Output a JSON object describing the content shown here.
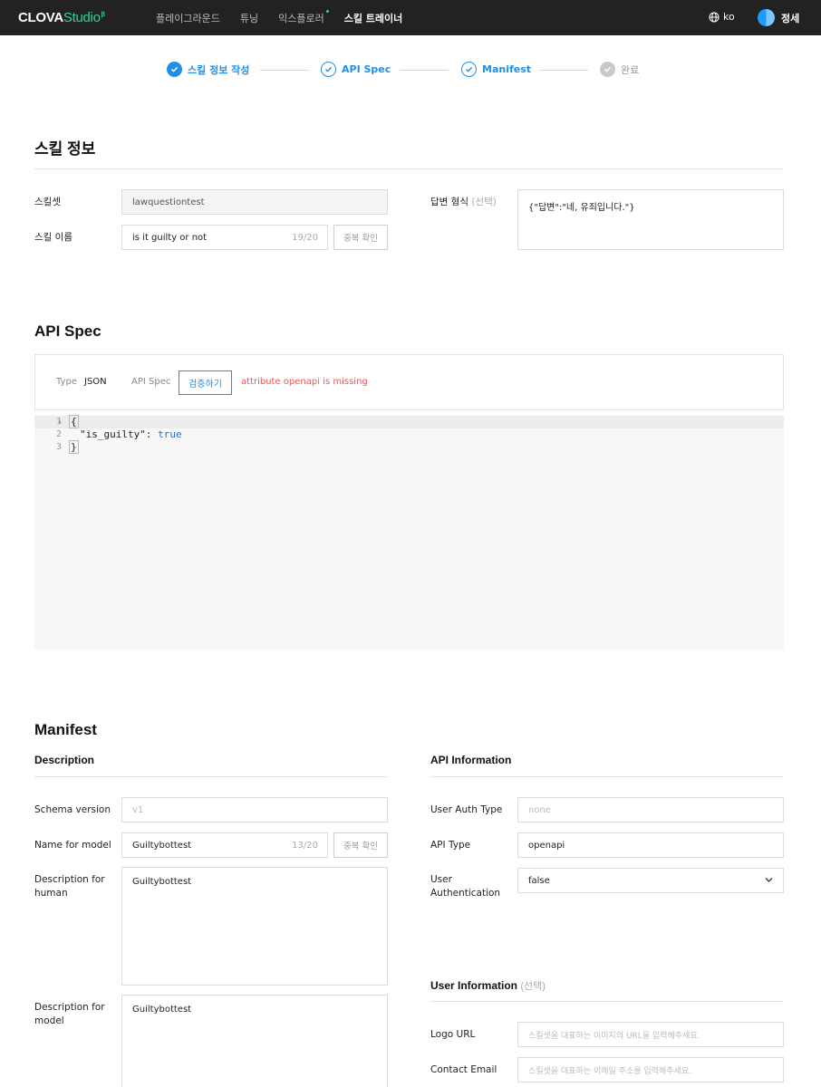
{
  "topbar": {
    "logo_main": "CLOVA",
    "logo_studio": "Studio",
    "logo_sup": "β",
    "nav": [
      "플레이그라운드",
      "튜닝",
      "익스플로러",
      "스킬 트레이너"
    ],
    "lang": "ko",
    "user_name": "정세"
  },
  "stepper": {
    "steps": [
      "스킬 정보 작성",
      "API Spec",
      "Manifest",
      "완료"
    ]
  },
  "skill_info": {
    "title": "스킬 정보",
    "skillset_label": "스킬셋",
    "skillset_value": "lawquestiontest",
    "skill_name_label": "스킬 이름",
    "skill_name_value": "is it guilty or not",
    "skill_name_count": "19/20",
    "dup_check": "중복 확인",
    "answer_format_label": "답변 형식",
    "answer_format_optional": "(선택)",
    "answer_format_value": "{\"답변\":\"네, 유죄입니다.\"}"
  },
  "api_spec": {
    "title": "API Spec",
    "type_label": "Type",
    "type_value": "JSON",
    "spec_label": "API Spec",
    "verify_button": "검증하기",
    "error": "attribute openapi is missing",
    "line_numbers": [
      "1",
      "2",
      "3"
    ],
    "code_open": "{",
    "code_key": "\"is_guilty\"",
    "code_colon": ": ",
    "code_value": "true",
    "code_close": "}"
  },
  "manifest": {
    "title": "Manifest",
    "description": {
      "title": "Description",
      "schema_version_label": "Schema version",
      "schema_version_placeholder": "v1",
      "name_for_model_label": "Name for model",
      "name_for_model_value": "Guiltybottest",
      "name_for_model_count": "13/20",
      "dup_check": "중복 확인",
      "desc_human_label": "Description for human",
      "desc_human_value": "Guiltybottest",
      "desc_model_label": "Description for model",
      "desc_model_value": "Guiltybottest"
    },
    "api_information": {
      "title": "API Information",
      "user_auth_type_label": "User Auth Type",
      "user_auth_type_placeholder": "none",
      "api_type_label": "API Type",
      "api_type_value": "openapi",
      "user_auth_label": "User Authentication",
      "user_auth_value": "false"
    },
    "user_information": {
      "title": "User Information",
      "optional": "(선택)",
      "logo_url_label": "Logo URL",
      "logo_url_placeholder": "스킬셋을 대표하는 이미지의 URL을 입력해주세요.",
      "contact_email_label": "Contact Email",
      "contact_email_placeholder": "스킬셋을 대표하는 이메일 주소를 입력해주세요."
    }
  }
}
